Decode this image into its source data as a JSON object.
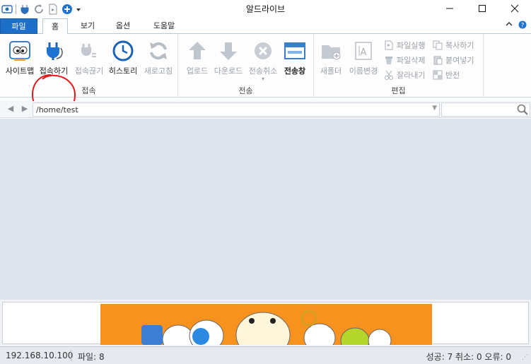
{
  "window": {
    "title": "알드라이브"
  },
  "tabs": {
    "file": "파일",
    "home": "홈",
    "view": "보기",
    "options": "옵션",
    "help": "도움말"
  },
  "ribbon": {
    "connect_group": {
      "label": "접속",
      "sitemap": "사이트맵",
      "connect": "접속하기",
      "disconnect": "접속끊기",
      "history": "히스토리",
      "refresh": "새로고침"
    },
    "transfer_group": {
      "label": "전송",
      "upload": "업로드",
      "download": "다운로드",
      "cancel": "전송취소",
      "window": "전송창"
    },
    "edit_group": {
      "label": "편집",
      "new_folder": "새폴더",
      "rename": "이름변경",
      "run_file": "파일실행",
      "delete_file": "파일삭제",
      "cut": "잘라내기",
      "copy": "복사하기",
      "paste": "붙여넣기",
      "invert": "반전"
    }
  },
  "address": {
    "path": "/home/test",
    "search_placeholder": ""
  },
  "status": {
    "ip": "192.168.10.100",
    "files": "파일: 8",
    "summary": "성공: 7 취소: 0 오류: 0"
  },
  "colors": {
    "file_tab": "#1d6fc7",
    "main_bg": "#dfe4ec",
    "banner": "#f7921e",
    "annotation": "#e0191c"
  }
}
